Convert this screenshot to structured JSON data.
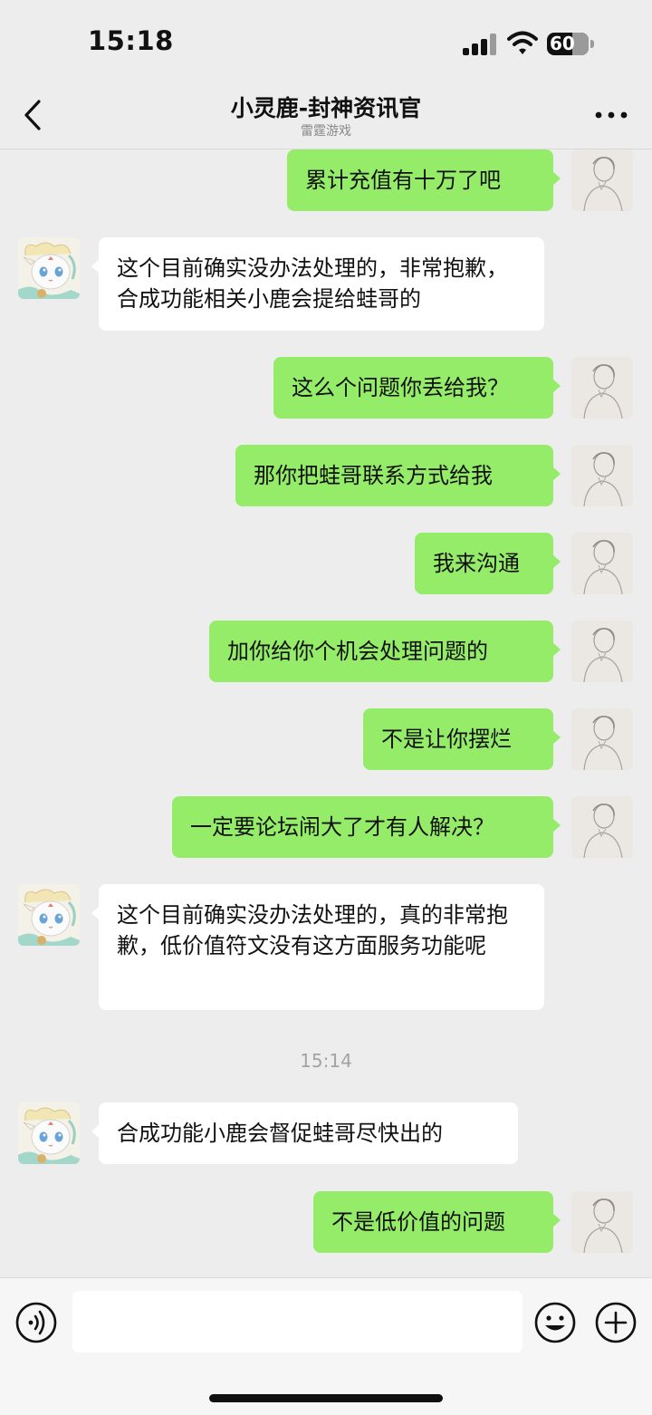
{
  "status_bar": {
    "time": "15:18",
    "battery": "60"
  },
  "header": {
    "title": "小灵鹿-封神资讯官",
    "subtitle": "雷霆游戏"
  },
  "messages": [
    {
      "sender": "me",
      "text": "累计充值有十万了吧"
    },
    {
      "sender": "bot",
      "text": "这个目前确实没办法处理的，非常抱歉，合成功能相关小鹿会提给蛙哥的"
    },
    {
      "sender": "me",
      "text": "这么个问题你丢给我？"
    },
    {
      "sender": "me",
      "text": "那你把蛙哥联系方式给我"
    },
    {
      "sender": "me",
      "text": "我来沟通"
    },
    {
      "sender": "me",
      "text": "加你给你个机会处理问题的"
    },
    {
      "sender": "me",
      "text": "不是让你摆烂"
    },
    {
      "sender": "me",
      "text": "一定要论坛闹大了才有人解决？"
    },
    {
      "sender": "bot",
      "text": "这个目前确实没办法处理的，真的非常抱歉，低价值符文没有这方面服务功能呢"
    },
    {
      "sender": "bot",
      "text": "合成功能小鹿会督促蛙哥尽快出的"
    },
    {
      "sender": "me",
      "text": "不是低价值的问题"
    }
  ],
  "timestamp": "15:14",
  "icons": {
    "back": "chevron-left-icon",
    "more": "more-icon",
    "voice": "voice-icon",
    "emoji": "emoji-icon",
    "plus": "plus-icon"
  },
  "colors": {
    "my_bubble": "#95ec69",
    "their_bubble": "#ffffff",
    "background": "#ededed"
  }
}
